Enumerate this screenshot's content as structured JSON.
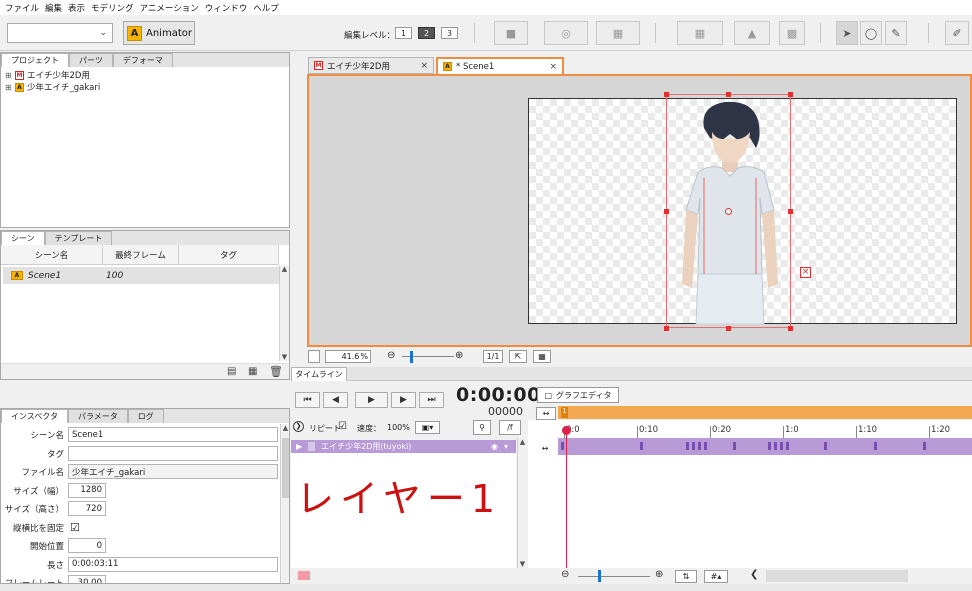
{
  "menu": [
    "ファイル",
    "編集",
    "表示",
    "モデリング",
    "アニメーション",
    "ウィンドウ",
    "ヘルプ"
  ],
  "toolbar": {
    "animator_label": "Animator",
    "edit_level_label": "編集レベル：",
    "levels": [
      "1",
      "2",
      "3"
    ],
    "active_level": "2"
  },
  "project_panel": {
    "tabs": [
      "プロジェクト",
      "パーツ",
      "デフォーマ"
    ],
    "items": [
      {
        "label": "エイチ少年2D用",
        "icon": "model"
      },
      {
        "label": "少年エイチ_gakari",
        "icon": "anim"
      }
    ]
  },
  "scene_panel": {
    "tabs": [
      "シーン",
      "テンプレート"
    ],
    "columns": [
      "シーン名",
      "最終フレーム",
      "タグ"
    ],
    "rows": [
      {
        "name": "Scene1",
        "last_frame": "100",
        "tag": ""
      }
    ]
  },
  "inspector": {
    "tabs": [
      "インスペクタ",
      "パラメータ",
      "ログ"
    ],
    "fields": [
      {
        "label": "シーン名",
        "value": "Scene1",
        "type": "text"
      },
      {
        "label": "タグ",
        "value": "",
        "type": "text"
      },
      {
        "label": "ファイル名",
        "value": "少年エイチ_gakari",
        "type": "ro"
      },
      {
        "label": "サイズ（幅）",
        "value": "1280",
        "type": "num"
      },
      {
        "label": "サイズ（高さ）",
        "value": "720",
        "type": "num"
      },
      {
        "label": "縦横比を固定",
        "value": "☑",
        "type": "check"
      },
      {
        "label": "開始位置",
        "value": "0",
        "type": "num"
      },
      {
        "label": "長さ",
        "value": "0:00:03:11",
        "type": "text"
      },
      {
        "label": "フレームレート",
        "value": "30.00",
        "type": "num"
      }
    ]
  },
  "doc_tabs": [
    {
      "label": "エイチ少年2D用",
      "icon": "model",
      "active": false
    },
    {
      "label": "* Scene1",
      "icon": "anim",
      "active": true
    }
  ],
  "zoom": {
    "value": "41.6",
    "unit": "%",
    "fit_label": "1/1"
  },
  "timeline": {
    "tab": "タイムライン",
    "time": "0:00:00",
    "frame": "00000",
    "repeat_label": "リピート",
    "repeat_check": "☑",
    "speed_label": "速度：",
    "speed_value": "100%",
    "fx_label": "/f",
    "graph_editor_label": "グラフエディタ",
    "layer_name": "エイチ少年2D用(tuyoki)",
    "ruler_labels": [
      "0:0",
      "0:10",
      "0:20",
      "1:0",
      "1:10",
      "1:20"
    ],
    "handwriting": "レイヤー1つ",
    "marker_label": "1"
  },
  "colors": {
    "accent_orange": "#f08c40",
    "layer_purple": "#b79ad6",
    "playhead_red": "#e0204a"
  }
}
